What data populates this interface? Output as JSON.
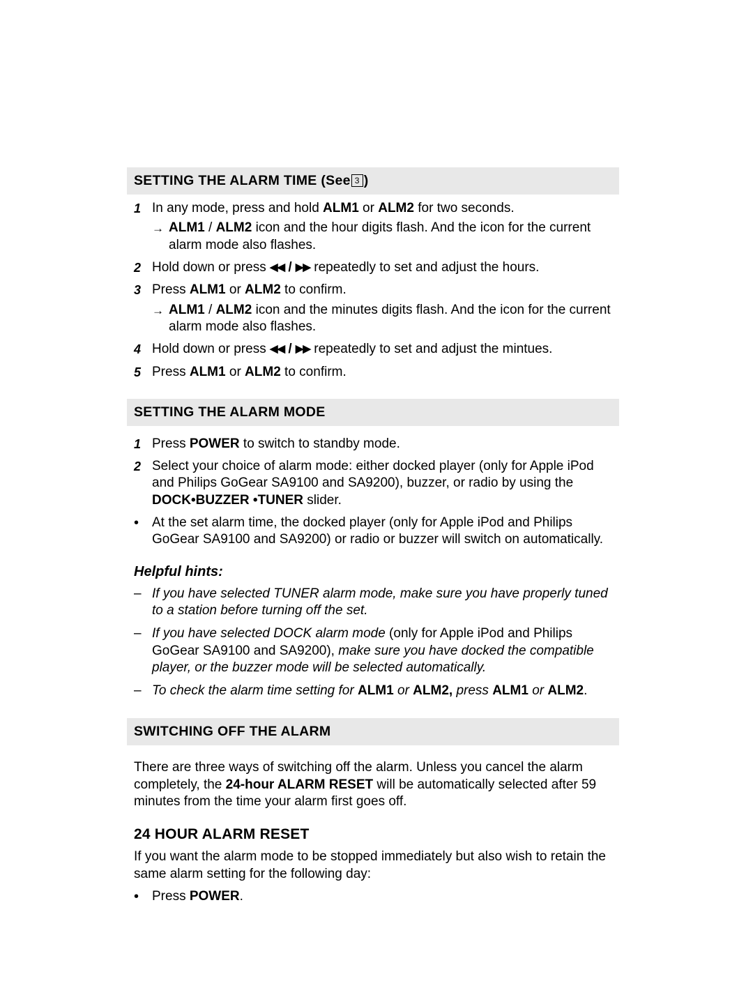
{
  "sections": [
    {
      "id": "setting-alarm-time",
      "heading_prefix": "SETTING THE ALARM TIME",
      "heading_see": "(See",
      "heading_ref": "3",
      "heading_close": ")",
      "steps": [
        {
          "num": "1",
          "html": "In any mode, press and hold <b>ALM1</b> or <b>ALM2</b> for two seconds."
        },
        {
          "arrow": "→",
          "html": "<b>ALM1</b> / <b>ALM2</b> icon and the hour digits flash. And the icon for the current alarm mode also flashes."
        },
        {
          "num": "2",
          "html": "Hold down or press <b class=\"nav-glyph\">◀◀</b> <b>/</b> <b class=\"nav-glyph\">▶▶</b> repeatedly to set and adjust the hours."
        },
        {
          "num": "3",
          "html": "Press <b>ALM1</b> or <b>ALM2</b> to confirm."
        },
        {
          "arrow": "→",
          "html": "<b>ALM1</b> / <b>ALM2</b> icon and the minutes digits flash. And the icon for the current alarm mode also flashes."
        },
        {
          "num": "4",
          "html": "Hold down or press <b class=\"nav-glyph\">◀◀</b> <b>/</b> <b class=\"nav-glyph\">▶▶</b> repeatedly to set and adjust the mintues."
        },
        {
          "num": "5",
          "html": "Press <b>ALM1</b> or <b>ALM2</b> to confirm."
        }
      ]
    },
    {
      "id": "setting-alarm-mode",
      "heading_prefix": "SETTING THE ALARM MODE",
      "steps": [
        {
          "num": "1",
          "html": "Press <b>POWER</b> to switch to standby mode."
        },
        {
          "num": "2",
          "html": "Select your choice of alarm mode: either docked player (only for Apple iPod and Philips GoGear SA9100 and SA9200), buzzer, or radio by using the <b>DOCK•BUZZER •TUNER</b> slider."
        },
        {
          "bullet": "•",
          "html": "At the set alarm time, the docked player (only for Apple iPod and Philips GoGear SA9100 and SA9200) or radio or buzzer will switch on automatically."
        }
      ],
      "hints_title": "Helpful hints:",
      "hints": [
        {
          "dash": "–",
          "html": "If you have selected TUNER alarm mode, make sure you have properly tuned to a station before turning off the set."
        },
        {
          "dash": "–",
          "html": "If you have selected DOCK alarm mode <span class=\"roman\">(only for Apple iPod and Philips GoGear SA9100 and SA9200),</span> make sure you have docked the compatible player, or the buzzer mode will be selected automatically."
        },
        {
          "dash": "–",
          "html": "To check the alarm time setting for <b class=\"roman\">ALM1</b> or <b class=\"roman\">ALM2,</b> press <b class=\"roman\">ALM1</b> or <b class=\"roman\">ALM2</b><span class=\"roman\">.</span>"
        }
      ]
    },
    {
      "id": "switching-off-alarm",
      "heading_prefix": "SWITCHING OFF THE ALARM",
      "paragraphs": [
        "There are three ways of switching off the alarm. Unless you cancel the alarm completely, the <b>24-hour ALARM RESET</b> will be automatically selected after 59 minutes from the time your alarm first goes off."
      ],
      "subhead": "24 HOUR ALARM RESET",
      "subhead_paragraph": "If you want the alarm mode to be stopped immediately but also wish to retain the same alarm setting for the following day:",
      "final_step": {
        "bullet": "•",
        "html": "Press <b>POWER</b>."
      }
    }
  ]
}
